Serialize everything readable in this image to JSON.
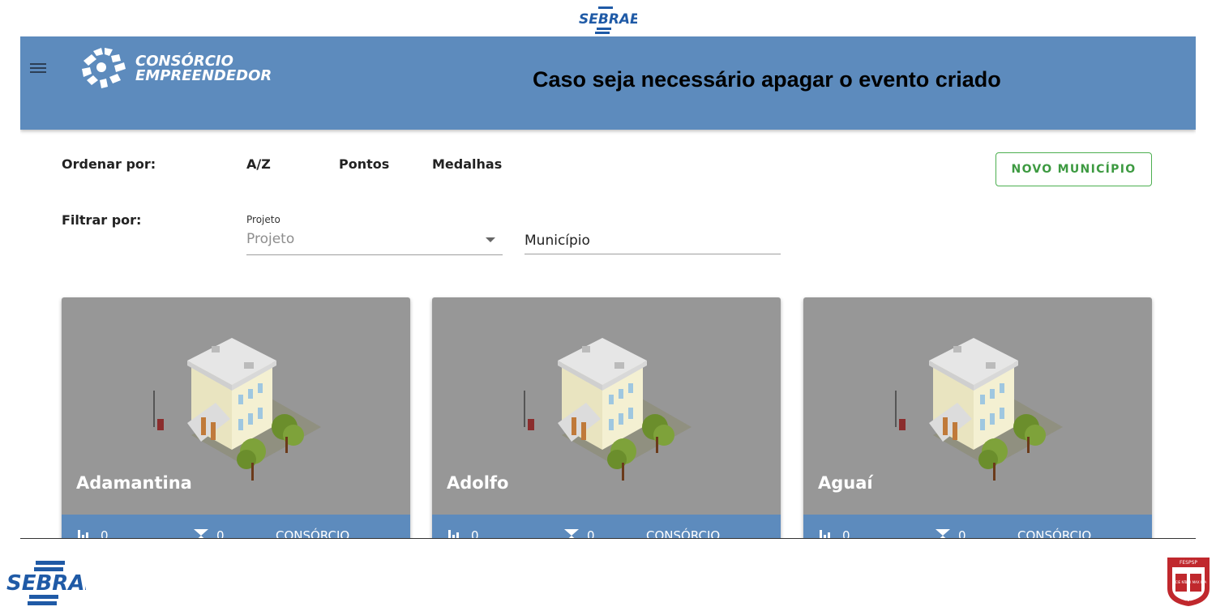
{
  "header_logo": {
    "text": "SEBRAE"
  },
  "app": {
    "brand": {
      "line1": "CONSÓRCIO",
      "line2": "EMPREENDEDOR"
    },
    "caption": "Caso seja necessário apagar o evento criado",
    "sort": {
      "label": "Ordenar por:",
      "options": [
        "A/Z",
        "Pontos",
        "Medalhas"
      ]
    },
    "new_button_label": "NOVO MUNICÍPIO",
    "filter": {
      "label": "Filtrar por:",
      "project_label": "Projeto",
      "project_value": "Projeto",
      "municipio_placeholder": "Município"
    },
    "cards": [
      {
        "name": "Adamantina",
        "rank": "0",
        "time": "0",
        "type": "CONSÓRCIO"
      },
      {
        "name": "Adolfo",
        "rank": "0",
        "time": "0",
        "type": "CONSÓRCIO"
      },
      {
        "name": "Aguaí",
        "rank": "0",
        "time": "0",
        "type": "CONSÓRCIO"
      }
    ]
  },
  "footer_logo": {
    "text": "SEBRAE"
  },
  "seal": {
    "top": "FESPSP",
    "left": "SCIE NTIA",
    "right": "LUX MAX IMA",
    "year": "1933"
  },
  "colors": {
    "appbar": "#5d8bbd",
    "card": "#979797",
    "accent_green": "#4caf50",
    "sebrae_blue": "#1f5aa6"
  }
}
